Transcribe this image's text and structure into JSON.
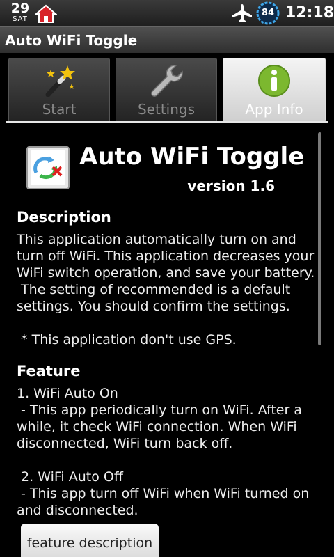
{
  "status": {
    "day": "29",
    "dow": "SAT",
    "battery": "84",
    "time": "12:18"
  },
  "app_bar": {
    "title": "Auto WiFi Toggle"
  },
  "tabs": [
    {
      "label": "Start",
      "icon": "magic-wand-icon",
      "selected": false
    },
    {
      "label": "Settings",
      "icon": "wrench-icon",
      "selected": false
    },
    {
      "label": "App Info",
      "icon": "info-icon",
      "selected": true
    }
  ],
  "info": {
    "title": "Auto WiFi Toggle",
    "version": "version 1.6",
    "description_heading": "Description",
    "description_text": "This application automatically turn on and turn off WiFi. This application decreases your WiFi switch operation, and save your battery.\n The setting of recommended is a default settings. You should confirm the settings.\n\n * This application don't use GPS.",
    "feature_heading": "Feature",
    "feature_text": "1. WiFi Auto On\n - This app periodically turn on WiFi. After a while, it check WiFi connection. When WiFi disconnected, WiFi turn back off.\n\n 2. WiFi Auto Off\n - This app turn off WiFi when WiFi turned on and disconnected.",
    "feature_button": "feature description"
  },
  "colors": {
    "info_green": "#7cb82f",
    "battery_ring": "#3fa6e8"
  }
}
